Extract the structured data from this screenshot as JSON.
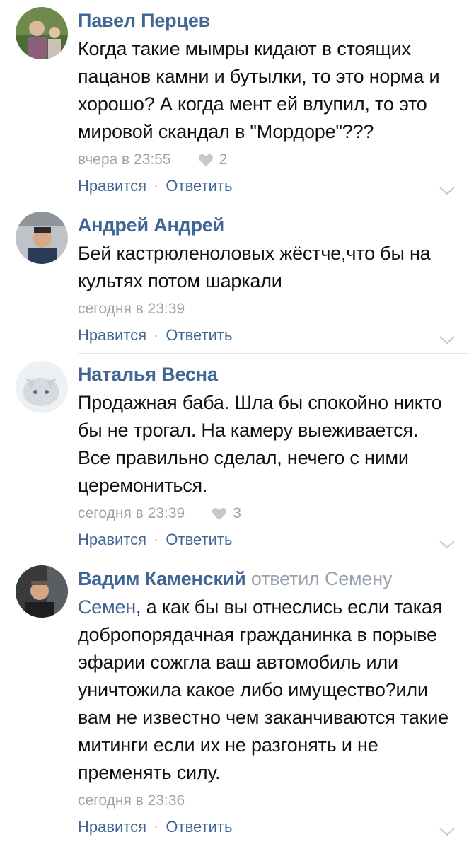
{
  "comments": [
    {
      "author": "Павел Перцев",
      "reply_note": "",
      "mention": "",
      "text": "Когда такие мымры кидают в стоящих пацанов камни и бутылки, то это норма и хорошо? А когда мент ей влупил, то это мировой скандал в \"Мордоре\"???",
      "time": "вчера в 23:55",
      "likes": "2",
      "like_label": "Нравится",
      "reply_label": "Ответить"
    },
    {
      "author": "Андрей Андрей",
      "reply_note": "",
      "mention": "",
      "text": "Бей кастрюленоловых жёстче,что бы на культях потом шаркали",
      "time": "сегодня в 23:39",
      "likes": "",
      "like_label": "Нравится",
      "reply_label": "Ответить"
    },
    {
      "author": "Наталья Весна",
      "reply_note": "",
      "mention": "",
      "text": "Продажная баба. Шла бы спокойно никто бы не трогал. На камеру выеживается. Все правильно сделал, нечего с ними церемониться.",
      "time": "сегодня в 23:39",
      "likes": "3",
      "like_label": "Нравится",
      "reply_label": "Ответить"
    },
    {
      "author": "Вадим Каменский",
      "reply_note": "ответил Семену",
      "mention": "Семен",
      "text": ", а как бы вы отнеслись если такая добропорядачная гражданинка в порыве эфарии сожгла ваш автомобиль или уничтожила какое либо имущество?или вам не известно чем заканчиваются такие митинги если их не разгонять и не пременять силу.",
      "time": "сегодня в 23:36",
      "likes": "",
      "like_label": "Нравится",
      "reply_label": "Ответить"
    }
  ],
  "colors": {
    "link": "#3f6694",
    "meta": "#9aa3ad",
    "divider": "#e3e6ea"
  },
  "icons": {
    "like": "heart-icon",
    "expand": "chevron-down-icon"
  }
}
